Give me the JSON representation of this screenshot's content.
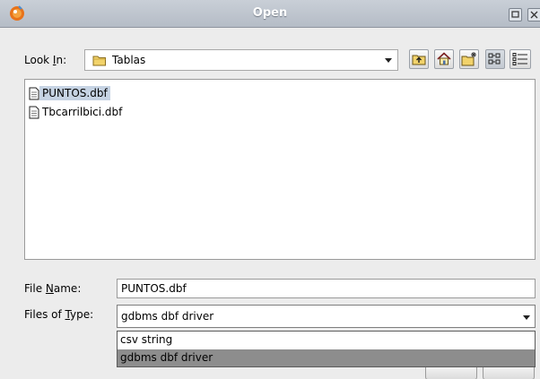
{
  "window": {
    "title": "Open"
  },
  "lookin": {
    "label_prefix": "Look ",
    "label_mnemonic": "I",
    "label_suffix": "n:",
    "value": "Tablas",
    "icon": "folder-icon"
  },
  "toolbar": {
    "buttons": [
      {
        "name": "up-folder-button",
        "icon": "up-folder-icon"
      },
      {
        "name": "home-button",
        "icon": "home-icon"
      },
      {
        "name": "new-folder-button",
        "icon": "new-folder-icon"
      },
      {
        "name": "list-view-button",
        "icon": "list-view-icon"
      },
      {
        "name": "details-view-button",
        "icon": "details-view-icon"
      }
    ]
  },
  "files": [
    {
      "name": "PUNTOS.dbf",
      "selected": true
    },
    {
      "name": "Tbcarrilbici.dbf",
      "selected": false
    }
  ],
  "filename": {
    "label_prefix": "File ",
    "label_mnemonic": "N",
    "label_suffix": "ame:",
    "value": "PUNTOS.dbf"
  },
  "filetype": {
    "label_prefix": "Files of ",
    "label_mnemonic": "T",
    "label_suffix": "ype:",
    "value": "gdbms dbf driver",
    "options": [
      {
        "label": "csv string",
        "selected": false
      },
      {
        "label": "gdbms dbf driver",
        "selected": true
      }
    ]
  }
}
